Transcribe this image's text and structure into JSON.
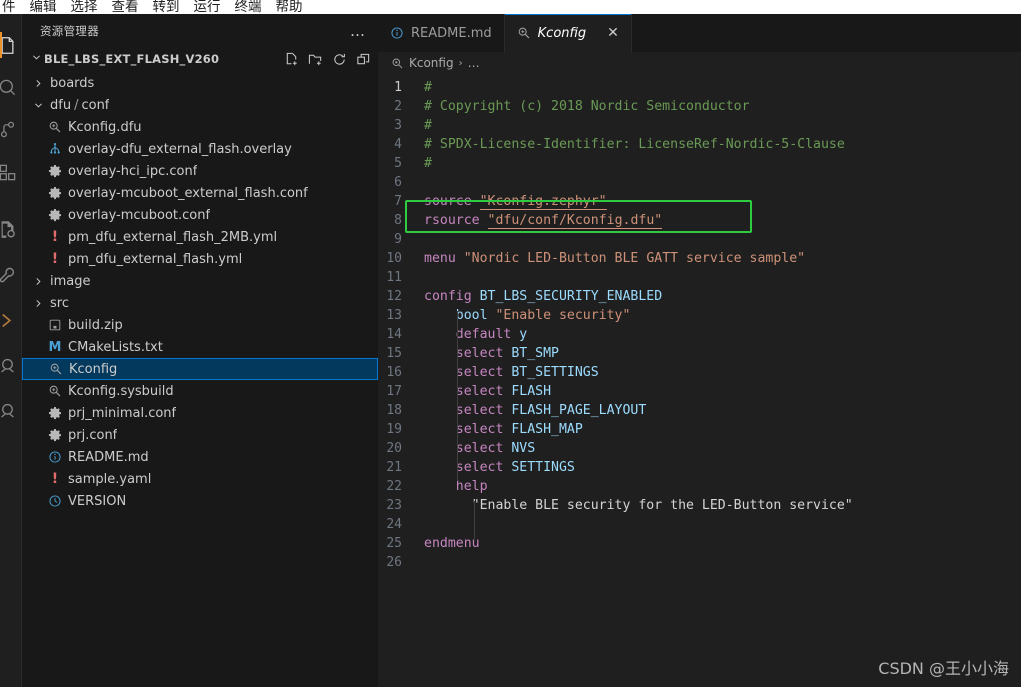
{
  "menubar": {
    "items": [
      {
        "label": "件"
      },
      {
        "label": "编辑"
      },
      {
        "label": "选择"
      },
      {
        "label": "查看"
      },
      {
        "label": "转到"
      },
      {
        "label": "运行"
      },
      {
        "label": "终端"
      },
      {
        "label": "帮助"
      }
    ]
  },
  "activitybar": {
    "items": [
      {
        "name": "explorer-icon",
        "active": true
      },
      {
        "name": "search-icon",
        "active": false
      },
      {
        "name": "source-control-icon",
        "active": false
      },
      {
        "name": "extensions-icon",
        "active": false
      },
      {
        "name": "config-file-icon",
        "active": false
      },
      {
        "name": "tools-icon",
        "active": false
      },
      {
        "name": "terminal-chevron-icon",
        "active": false
      },
      {
        "name": "nordic-connect-icon",
        "active": false
      },
      {
        "name": "nordic-kconfig-icon",
        "active": false
      }
    ]
  },
  "sidebar": {
    "header_title": "资源管理器",
    "more_actions": "…",
    "project": {
      "name": "BLE_LBS_EXT_FLASH_V260",
      "expanded": true,
      "actions": [
        "new-file-icon",
        "new-folder-icon",
        "refresh-icon",
        "collapse-all-icon"
      ]
    },
    "tree": [
      {
        "label": "boards",
        "icon": "folder",
        "twisty": "collapsed",
        "indent": 1
      },
      {
        "label": "dfu / conf",
        "icon": "folder",
        "twisty": "expanded",
        "indent": 1,
        "compound": true,
        "part1": "dfu",
        "sep": "/",
        "part2": "conf"
      },
      {
        "label": "Kconfig.dfu",
        "icon": "kconfig",
        "twisty": "none",
        "indent": 2
      },
      {
        "label": "overlay-dfu_external_flash.overlay",
        "icon": "devicetree",
        "twisty": "none",
        "indent": 2
      },
      {
        "label": "overlay-hci_ipc.conf",
        "icon": "gear",
        "twisty": "none",
        "indent": 2
      },
      {
        "label": "overlay-mcuboot_external_flash.conf",
        "icon": "gear",
        "twisty": "none",
        "indent": 2
      },
      {
        "label": "overlay-mcuboot.conf",
        "icon": "gear",
        "twisty": "none",
        "indent": 2
      },
      {
        "label": "pm_dfu_external_flash_2MB.yml",
        "icon": "yaml",
        "twisty": "none",
        "indent": 2
      },
      {
        "label": "pm_dfu_external_flash.yml",
        "icon": "yaml",
        "twisty": "none",
        "indent": 2
      },
      {
        "label": "image",
        "icon": "folder",
        "twisty": "collapsed",
        "indent": 1
      },
      {
        "label": "src",
        "icon": "folder",
        "twisty": "collapsed",
        "indent": 1
      },
      {
        "label": "build.zip",
        "icon": "zip",
        "twisty": "none",
        "indent": 1
      },
      {
        "label": "CMakeLists.txt",
        "icon": "cmake",
        "twisty": "none",
        "indent": 1
      },
      {
        "label": "Kconfig",
        "icon": "kconfig",
        "twisty": "none",
        "indent": 1,
        "selected": true
      },
      {
        "label": "Kconfig.sysbuild",
        "icon": "kconfig",
        "twisty": "none",
        "indent": 1
      },
      {
        "label": "prj_minimal.conf",
        "icon": "gear",
        "twisty": "none",
        "indent": 1
      },
      {
        "label": "prj.conf",
        "icon": "gear",
        "twisty": "none",
        "indent": 1
      },
      {
        "label": "README.md",
        "icon": "info",
        "twisty": "none",
        "indent": 1
      },
      {
        "label": "sample.yaml",
        "icon": "yaml",
        "twisty": "none",
        "indent": 1
      },
      {
        "label": "VERSION",
        "icon": "clock",
        "twisty": "none",
        "indent": 1
      }
    ]
  },
  "editor": {
    "tabs": [
      {
        "label": "README.md",
        "icon": "info",
        "active": false,
        "closable": false
      },
      {
        "label": "Kconfig",
        "icon": "kconfig",
        "active": true,
        "closable": true,
        "close_glyph": "✕"
      }
    ],
    "breadcrumb": {
      "icon": "kconfig",
      "root": "Kconfig",
      "chevron": "›",
      "more": "…"
    },
    "lines": [
      {
        "n": "1",
        "tokens": [
          {
            "t": "#",
            "c": "comment"
          }
        ]
      },
      {
        "n": "2",
        "tokens": [
          {
            "t": "# Copyright (c) 2018 Nordic Semiconductor",
            "c": "comment"
          }
        ]
      },
      {
        "n": "3",
        "tokens": [
          {
            "t": "#",
            "c": "comment"
          }
        ]
      },
      {
        "n": "4",
        "tokens": [
          {
            "t": "# SPDX-License-Identifier: LicenseRef-Nordic-5-Clause",
            "c": "comment"
          }
        ]
      },
      {
        "n": "5",
        "tokens": [
          {
            "t": "#",
            "c": "comment"
          }
        ]
      },
      {
        "n": "6",
        "tokens": []
      },
      {
        "n": "7",
        "tokens": [
          {
            "t": "source ",
            "c": "kw"
          },
          {
            "t": "\"Kconfig.zephyr\"",
            "c": "str-u"
          }
        ]
      },
      {
        "n": "8",
        "tokens": [
          {
            "t": "rsource ",
            "c": "kw"
          },
          {
            "t": "\"dfu/conf/Kconfig.dfu\"",
            "c": "str-u"
          }
        ]
      },
      {
        "n": "9",
        "tokens": []
      },
      {
        "n": "10",
        "tokens": [
          {
            "t": "menu ",
            "c": "kw"
          },
          {
            "t": "\"Nordic LED-Button BLE GATT service sample\"",
            "c": "str"
          }
        ]
      },
      {
        "n": "11",
        "tokens": []
      },
      {
        "n": "12",
        "tokens": [
          {
            "t": "config ",
            "c": "kw"
          },
          {
            "t": "BT_LBS_SECURITY_ENABLED",
            "c": "ident"
          }
        ]
      },
      {
        "n": "13",
        "tokens": [
          {
            "t": "    ",
            "c": "plain"
          },
          {
            "t": "bool ",
            "c": "ident"
          },
          {
            "t": "\"Enable security\"",
            "c": "str"
          }
        ]
      },
      {
        "n": "14",
        "tokens": [
          {
            "t": "    ",
            "c": "plain"
          },
          {
            "t": "default ",
            "c": "kw"
          },
          {
            "t": "y",
            "c": "ident"
          }
        ]
      },
      {
        "n": "15",
        "tokens": [
          {
            "t": "    ",
            "c": "plain"
          },
          {
            "t": "select ",
            "c": "kw"
          },
          {
            "t": "BT_SMP",
            "c": "ident"
          }
        ]
      },
      {
        "n": "16",
        "tokens": [
          {
            "t": "    ",
            "c": "plain"
          },
          {
            "t": "select ",
            "c": "kw"
          },
          {
            "t": "BT_SETTINGS",
            "c": "ident"
          }
        ]
      },
      {
        "n": "17",
        "tokens": [
          {
            "t": "    ",
            "c": "plain"
          },
          {
            "t": "select ",
            "c": "kw"
          },
          {
            "t": "FLASH",
            "c": "ident"
          }
        ]
      },
      {
        "n": "18",
        "tokens": [
          {
            "t": "    ",
            "c": "plain"
          },
          {
            "t": "select ",
            "c": "kw"
          },
          {
            "t": "FLASH_PAGE_LAYOUT",
            "c": "ident"
          }
        ]
      },
      {
        "n": "19",
        "tokens": [
          {
            "t": "    ",
            "c": "plain"
          },
          {
            "t": "select ",
            "c": "kw"
          },
          {
            "t": "FLASH_MAP",
            "c": "ident"
          }
        ]
      },
      {
        "n": "20",
        "tokens": [
          {
            "t": "    ",
            "c": "plain"
          },
          {
            "t": "select ",
            "c": "kw"
          },
          {
            "t": "NVS",
            "c": "ident"
          }
        ]
      },
      {
        "n": "21",
        "tokens": [
          {
            "t": "    ",
            "c": "plain"
          },
          {
            "t": "select ",
            "c": "kw"
          },
          {
            "t": "SETTINGS",
            "c": "ident"
          }
        ]
      },
      {
        "n": "22",
        "tokens": [
          {
            "t": "    ",
            "c": "plain"
          },
          {
            "t": "help",
            "c": "kw"
          }
        ]
      },
      {
        "n": "23",
        "tokens": [
          {
            "t": "      ",
            "c": "plain"
          },
          {
            "t": "\"Enable BLE security for the LED-Button service\"",
            "c": "help"
          }
        ]
      },
      {
        "n": "24",
        "tokens": []
      },
      {
        "n": "25",
        "tokens": [
          {
            "t": "endmenu",
            "c": "kw"
          }
        ]
      },
      {
        "n": "26",
        "tokens": []
      }
    ]
  },
  "annotation": {
    "name": "highlight-rectangle",
    "color": "#2ecc40",
    "target_line": "8"
  },
  "watermark": {
    "text": "CSDN @王小小海"
  },
  "colors": {
    "accent": "#0078d4",
    "selection_bg": "#04395e",
    "editor_bg": "#1f1f1f",
    "sidebar_bg": "#181818",
    "annotation": "#2ecc40"
  }
}
